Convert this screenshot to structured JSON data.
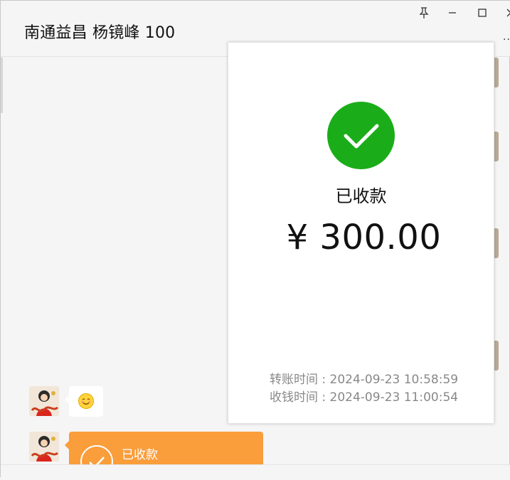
{
  "window": {
    "chat_title": "南通益昌 杨镜峰 100",
    "controls": [
      "pin-icon",
      "minimize-icon",
      "maximize-icon",
      "close-icon"
    ],
    "more_label": "..."
  },
  "messages": [
    {
      "type": "emoji",
      "emoji": "smiling-face-emoji"
    },
    {
      "type": "transfer",
      "label": "已收款",
      "color": "#fa9d3b"
    }
  ],
  "receipt": {
    "status": "已收款",
    "amount": "¥ 300.00",
    "accent_color": "#1aad19",
    "times": [
      "转账时间 : 2024-09-23 10:58:59",
      "收钱时间 : 2024-09-23 11:00:54"
    ]
  }
}
